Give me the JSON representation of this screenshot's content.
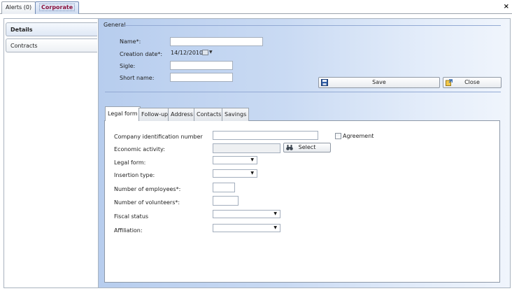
{
  "top_tabs": [
    {
      "label": "Alerts (0)"
    },
    {
      "label": "Corporate"
    }
  ],
  "close_symbol": "×",
  "side_tabs": [
    {
      "label": "Details"
    },
    {
      "label": "Contracts"
    }
  ],
  "general": {
    "title": "General",
    "name_label": "Name*:",
    "name_value": "",
    "creation_label": "Creation date*:",
    "creation_value": "14/12/2010",
    "sigle_label": "Sigle:",
    "short_name_label": "Short name:"
  },
  "buttons": {
    "save": "Save",
    "close": "Close"
  },
  "inner_tabs": [
    {
      "label": "Legal form"
    },
    {
      "label": "Follow-up"
    },
    {
      "label": "Address"
    },
    {
      "label": "Contacts"
    },
    {
      "label": "Savings"
    }
  ],
  "legal": {
    "company_id_label": "Company identification number",
    "agreement_label": "Agreement",
    "economic_activity_label": "Economic activity:",
    "select_button": "Select",
    "legal_form_label": "Legal form:",
    "insertion_type_label": "Insertion type:",
    "employees_label": "Number of employees*:",
    "volunteers_label": "Number of volunteers*:",
    "fiscal_status_label": "Fiscal status",
    "affiliation_label": "Affiliation:"
  },
  "colors": {
    "accent_tab_text": "#8a0f3a",
    "panel_gradient_start": "#b7cdee"
  }
}
